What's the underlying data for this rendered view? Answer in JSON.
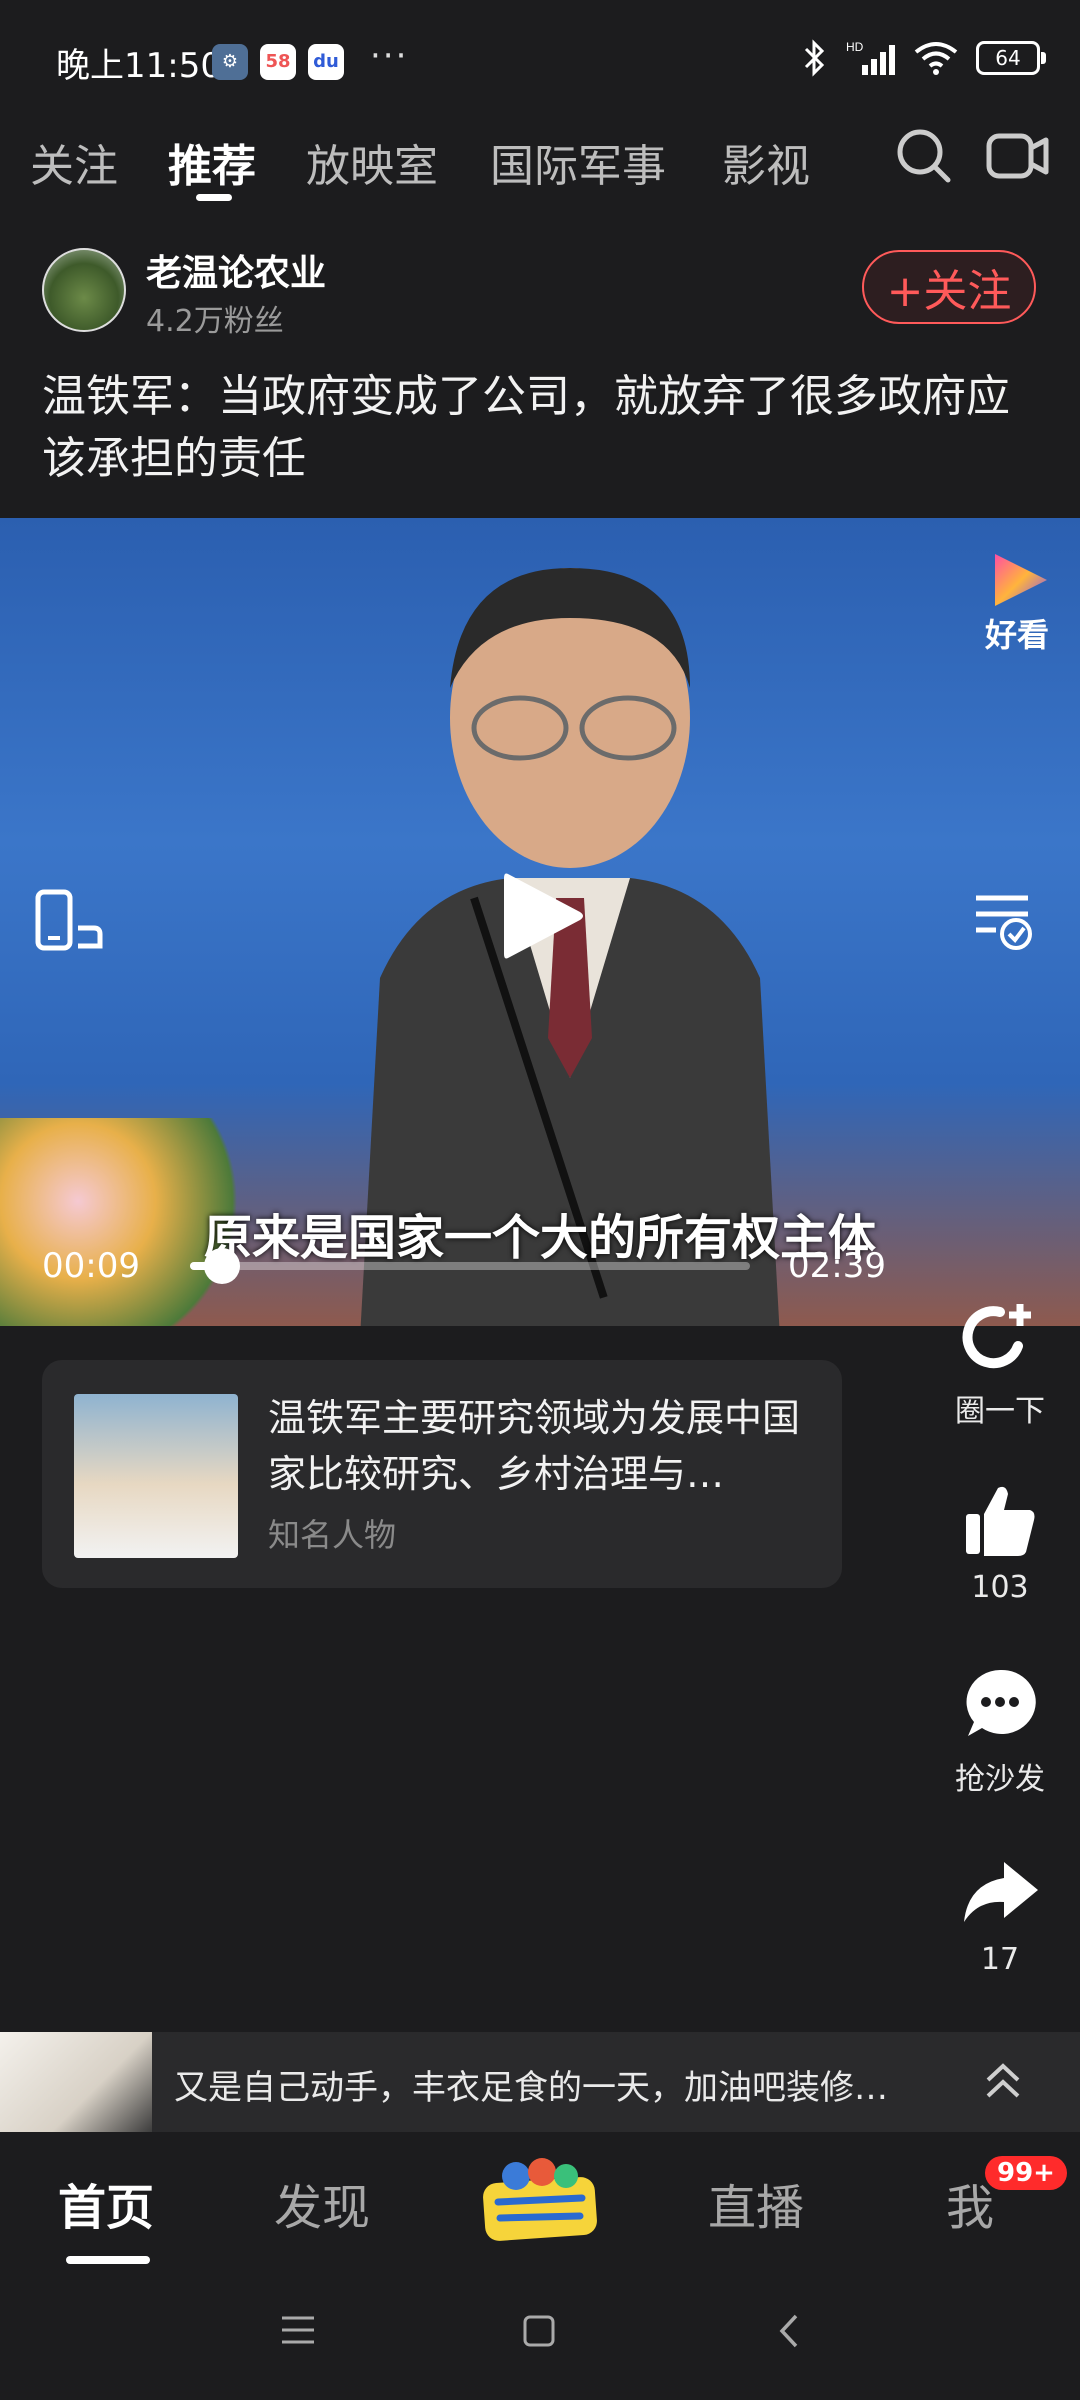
{
  "status_bar": {
    "time": "晚上11:50",
    "app_badge_58": "58",
    "dots": "···",
    "battery": "64"
  },
  "top_tabs": [
    "关注",
    "推荐",
    "放映室",
    "国际军事",
    "影视"
  ],
  "author": {
    "name": "老温论农业",
    "fans": "4.2万粉丝",
    "follow_label": "+关注"
  },
  "post_title": "温铁军：当政府变成了公司，就放弃了很多政府应该承担的责任",
  "video": {
    "subtitle": "原来是国家一个大的所有权主体",
    "current_time": "00:09",
    "total_time": "02:39",
    "progress": 0.057,
    "brand_label": "好看"
  },
  "info_card": {
    "text": "温铁军主要研究领域为发展中国家比较研究、乡村治理与…",
    "subtitle": "知名人物"
  },
  "actions": {
    "circle_label": "圈一下",
    "like_count": "103",
    "comment_label": "抢沙发",
    "share_count": "17"
  },
  "suggestion": {
    "text": "又是自己动手，丰衣足食的一天，加油吧装修…"
  },
  "bottom_nav": {
    "home": "首页",
    "discover": "发现",
    "live": "直播",
    "me": "我",
    "badge": "99+"
  },
  "colors": {
    "background": "#1c1c1e",
    "follow_red": "#ff5a5a",
    "badge_red": "#ff2b2b"
  }
}
